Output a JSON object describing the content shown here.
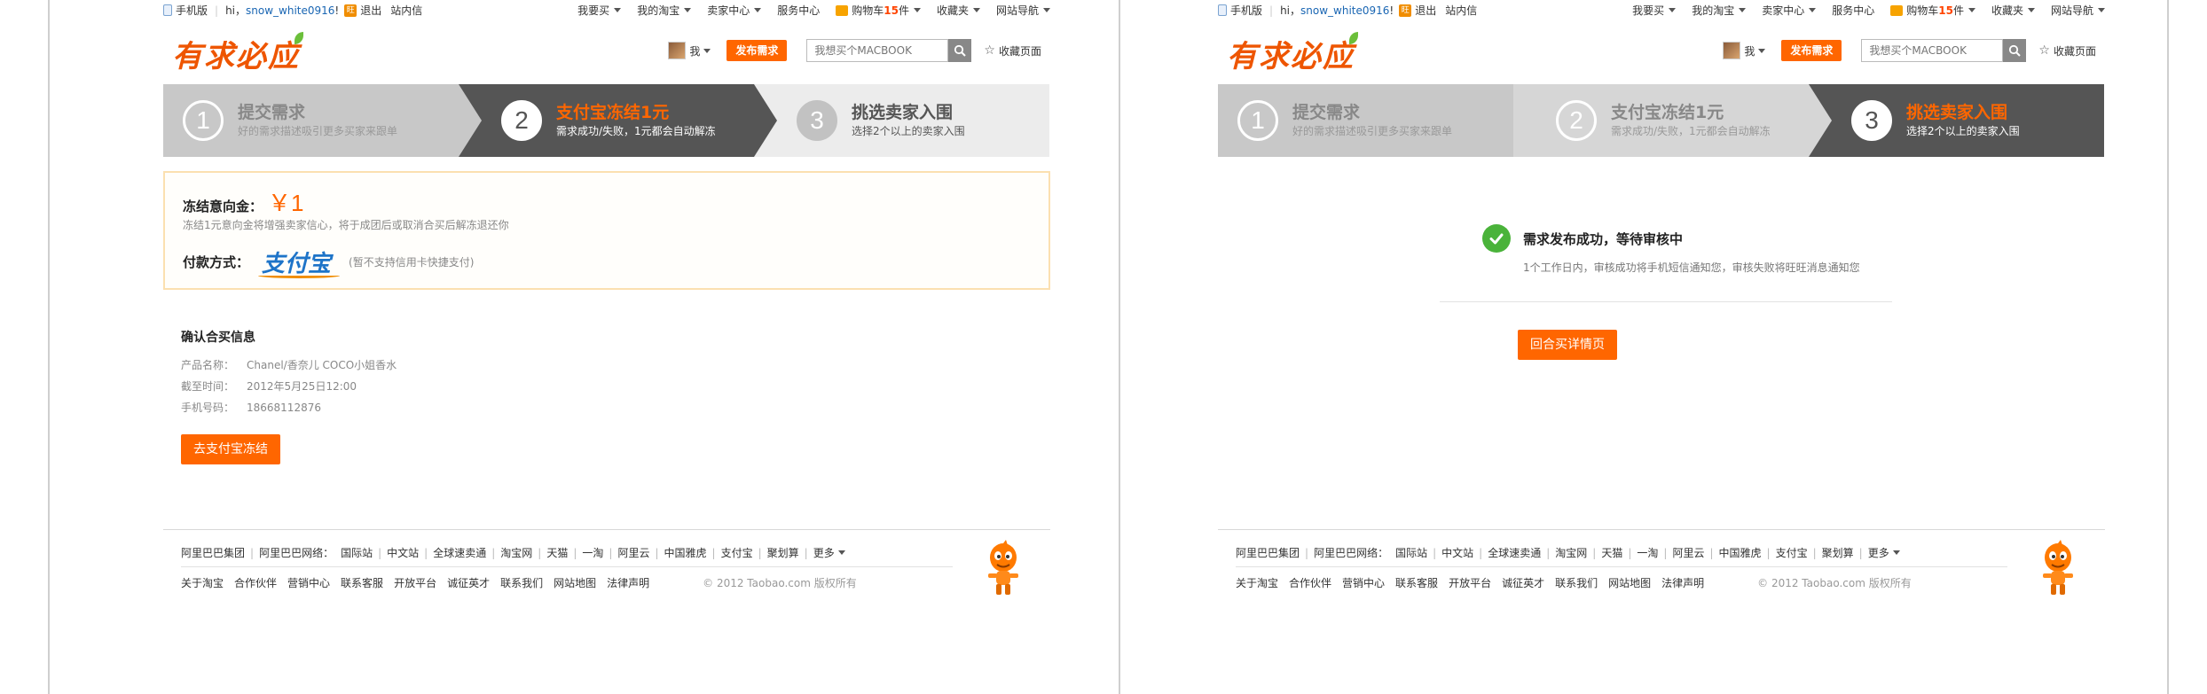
{
  "topbar": {
    "mobile": "手机版",
    "greeting": "hi，",
    "username": "snow_white0916",
    "exclaim": "!",
    "logout": "退出",
    "messages": "站内信",
    "want_buy": "我要买",
    "my_taobao": "我的淘宝",
    "seller_center": "卖家中心",
    "service_center": "服务中心",
    "cart_label": "购物车",
    "cart_count": "15",
    "cart_unit": "件",
    "favorites": "收藏夹",
    "site_nav": "网站导航"
  },
  "header": {
    "logo": "有求必应",
    "me": "我",
    "publish": "发布需求",
    "search_placeholder": "我想买个MACBOOK",
    "bookmark": "收藏页面"
  },
  "steps": [
    {
      "num": "1",
      "title": "提交需求",
      "desc": "好的需求描述吸引更多买家来跟单"
    },
    {
      "num": "2",
      "title": "支付宝冻结1元",
      "desc": "需求成功/失败，1元都会自动解冻"
    },
    {
      "num": "3",
      "title": "挑选卖家入围",
      "desc": "选择2个以上的卖家入围"
    }
  ],
  "left": {
    "deposit_label": "冻结意向金：",
    "deposit_amount": "￥1",
    "deposit_note": "冻结1元意向金将增强卖家信心，将于成团后或取消合买后解冻退还你",
    "pay_method_label": "付款方式：",
    "alipay_logo": "支付宝",
    "pay_hint": "(暂不支持信用卡快捷支付)",
    "confirm_title": "确认合买信息",
    "info": [
      {
        "key": "产品名称：",
        "value": "Chanel/香奈儿 COCO小姐香水"
      },
      {
        "key": "截至时间：",
        "value": "2012年5月25日12:00"
      },
      {
        "key": "手机号码：",
        "value": "18668112876"
      }
    ],
    "pay_button": "去支付宝冻结"
  },
  "right": {
    "success_title": "需求发布成功，等待审核中",
    "success_sub": "1个工作日内，审核成功将手机短信通知您，审核失败将旺旺消息通知您",
    "back_button": "回合买详情页"
  },
  "footer": {
    "links1": [
      "阿里巴巴集团",
      "阿里巴巴网络：",
      "国际站",
      "中文站",
      "全球速卖通",
      "淘宝网",
      "天猫",
      "一淘",
      "阿里云",
      "中国雅虎",
      "支付宝",
      "聚划算",
      "更多"
    ],
    "links2": [
      "关于淘宝",
      "合作伙伴",
      "营销中心",
      "联系客服",
      "开放平台",
      "诚征英才",
      "联系我们",
      "网站地图",
      "法律声明"
    ],
    "copyright": "© 2012 Taobao.com 版权所有"
  },
  "colors": {
    "accent": "#ff6600",
    "step_active": "#555555",
    "step_done": "#c8c8c8",
    "step_todo": "#ececec",
    "success_green": "#4ab33a"
  },
  "icons": [
    "phone-icon",
    "wangwang-icon",
    "cart-icon",
    "chevron-down-icon",
    "search-icon",
    "star-icon",
    "check-icon",
    "mascot-icon"
  ]
}
